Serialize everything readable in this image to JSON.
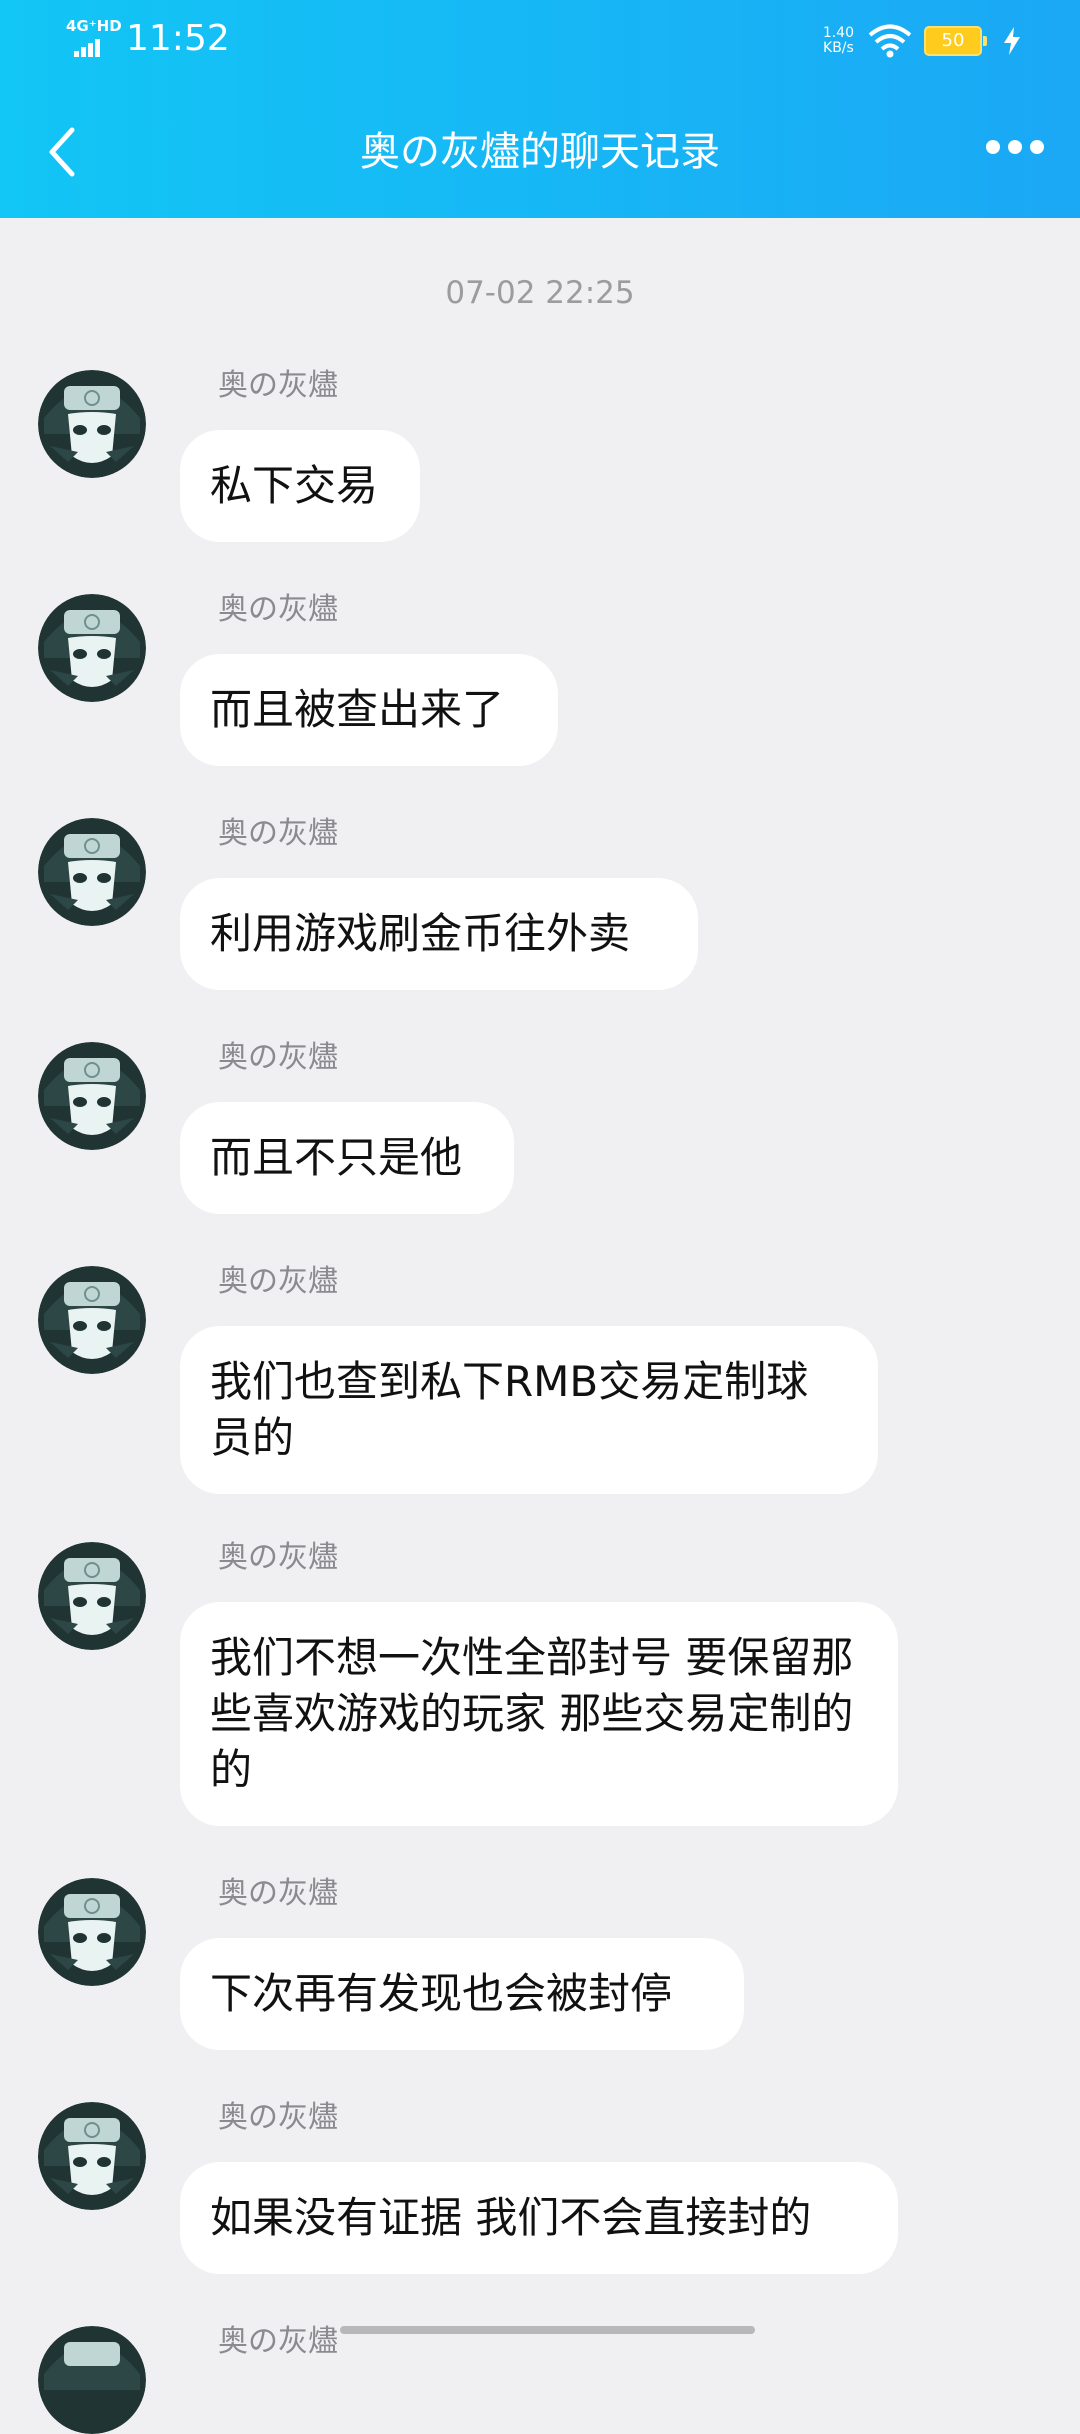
{
  "status_bar": {
    "network": "4G⁺HD",
    "time": "11:52",
    "speed_value": "1.40",
    "speed_unit": "KB/s",
    "battery": "50"
  },
  "header": {
    "title": "奥の灰燼的聊天记录",
    "back_icon": "chevron-left-icon",
    "more_icon": "more-dots-icon"
  },
  "timestamp": "07-02 22:25",
  "messages": [
    {
      "sender": "奥の灰燼",
      "text": "私下交易"
    },
    {
      "sender": "奥の灰燼",
      "text": "而且被查出来了"
    },
    {
      "sender": "奥の灰燼",
      "text": "利用游戏刷金币往外卖"
    },
    {
      "sender": "奥の灰燼",
      "text": "而且不只是他"
    },
    {
      "sender": "奥の灰燼",
      "text": "我们也查到私下RMB交易定制球员的"
    },
    {
      "sender": "奥の灰燼",
      "text": "我们不想一次性全部封号 要保留那些喜欢游戏的玩家 那些交易定制的的"
    },
    {
      "sender": "奥の灰燼",
      "text": "下次再有发现也会被封停"
    },
    {
      "sender": "奥の灰燼",
      "text": "如果没有证据 我们不会直接封的"
    },
    {
      "sender": "奥の灰燼",
      "text": ""
    }
  ]
}
